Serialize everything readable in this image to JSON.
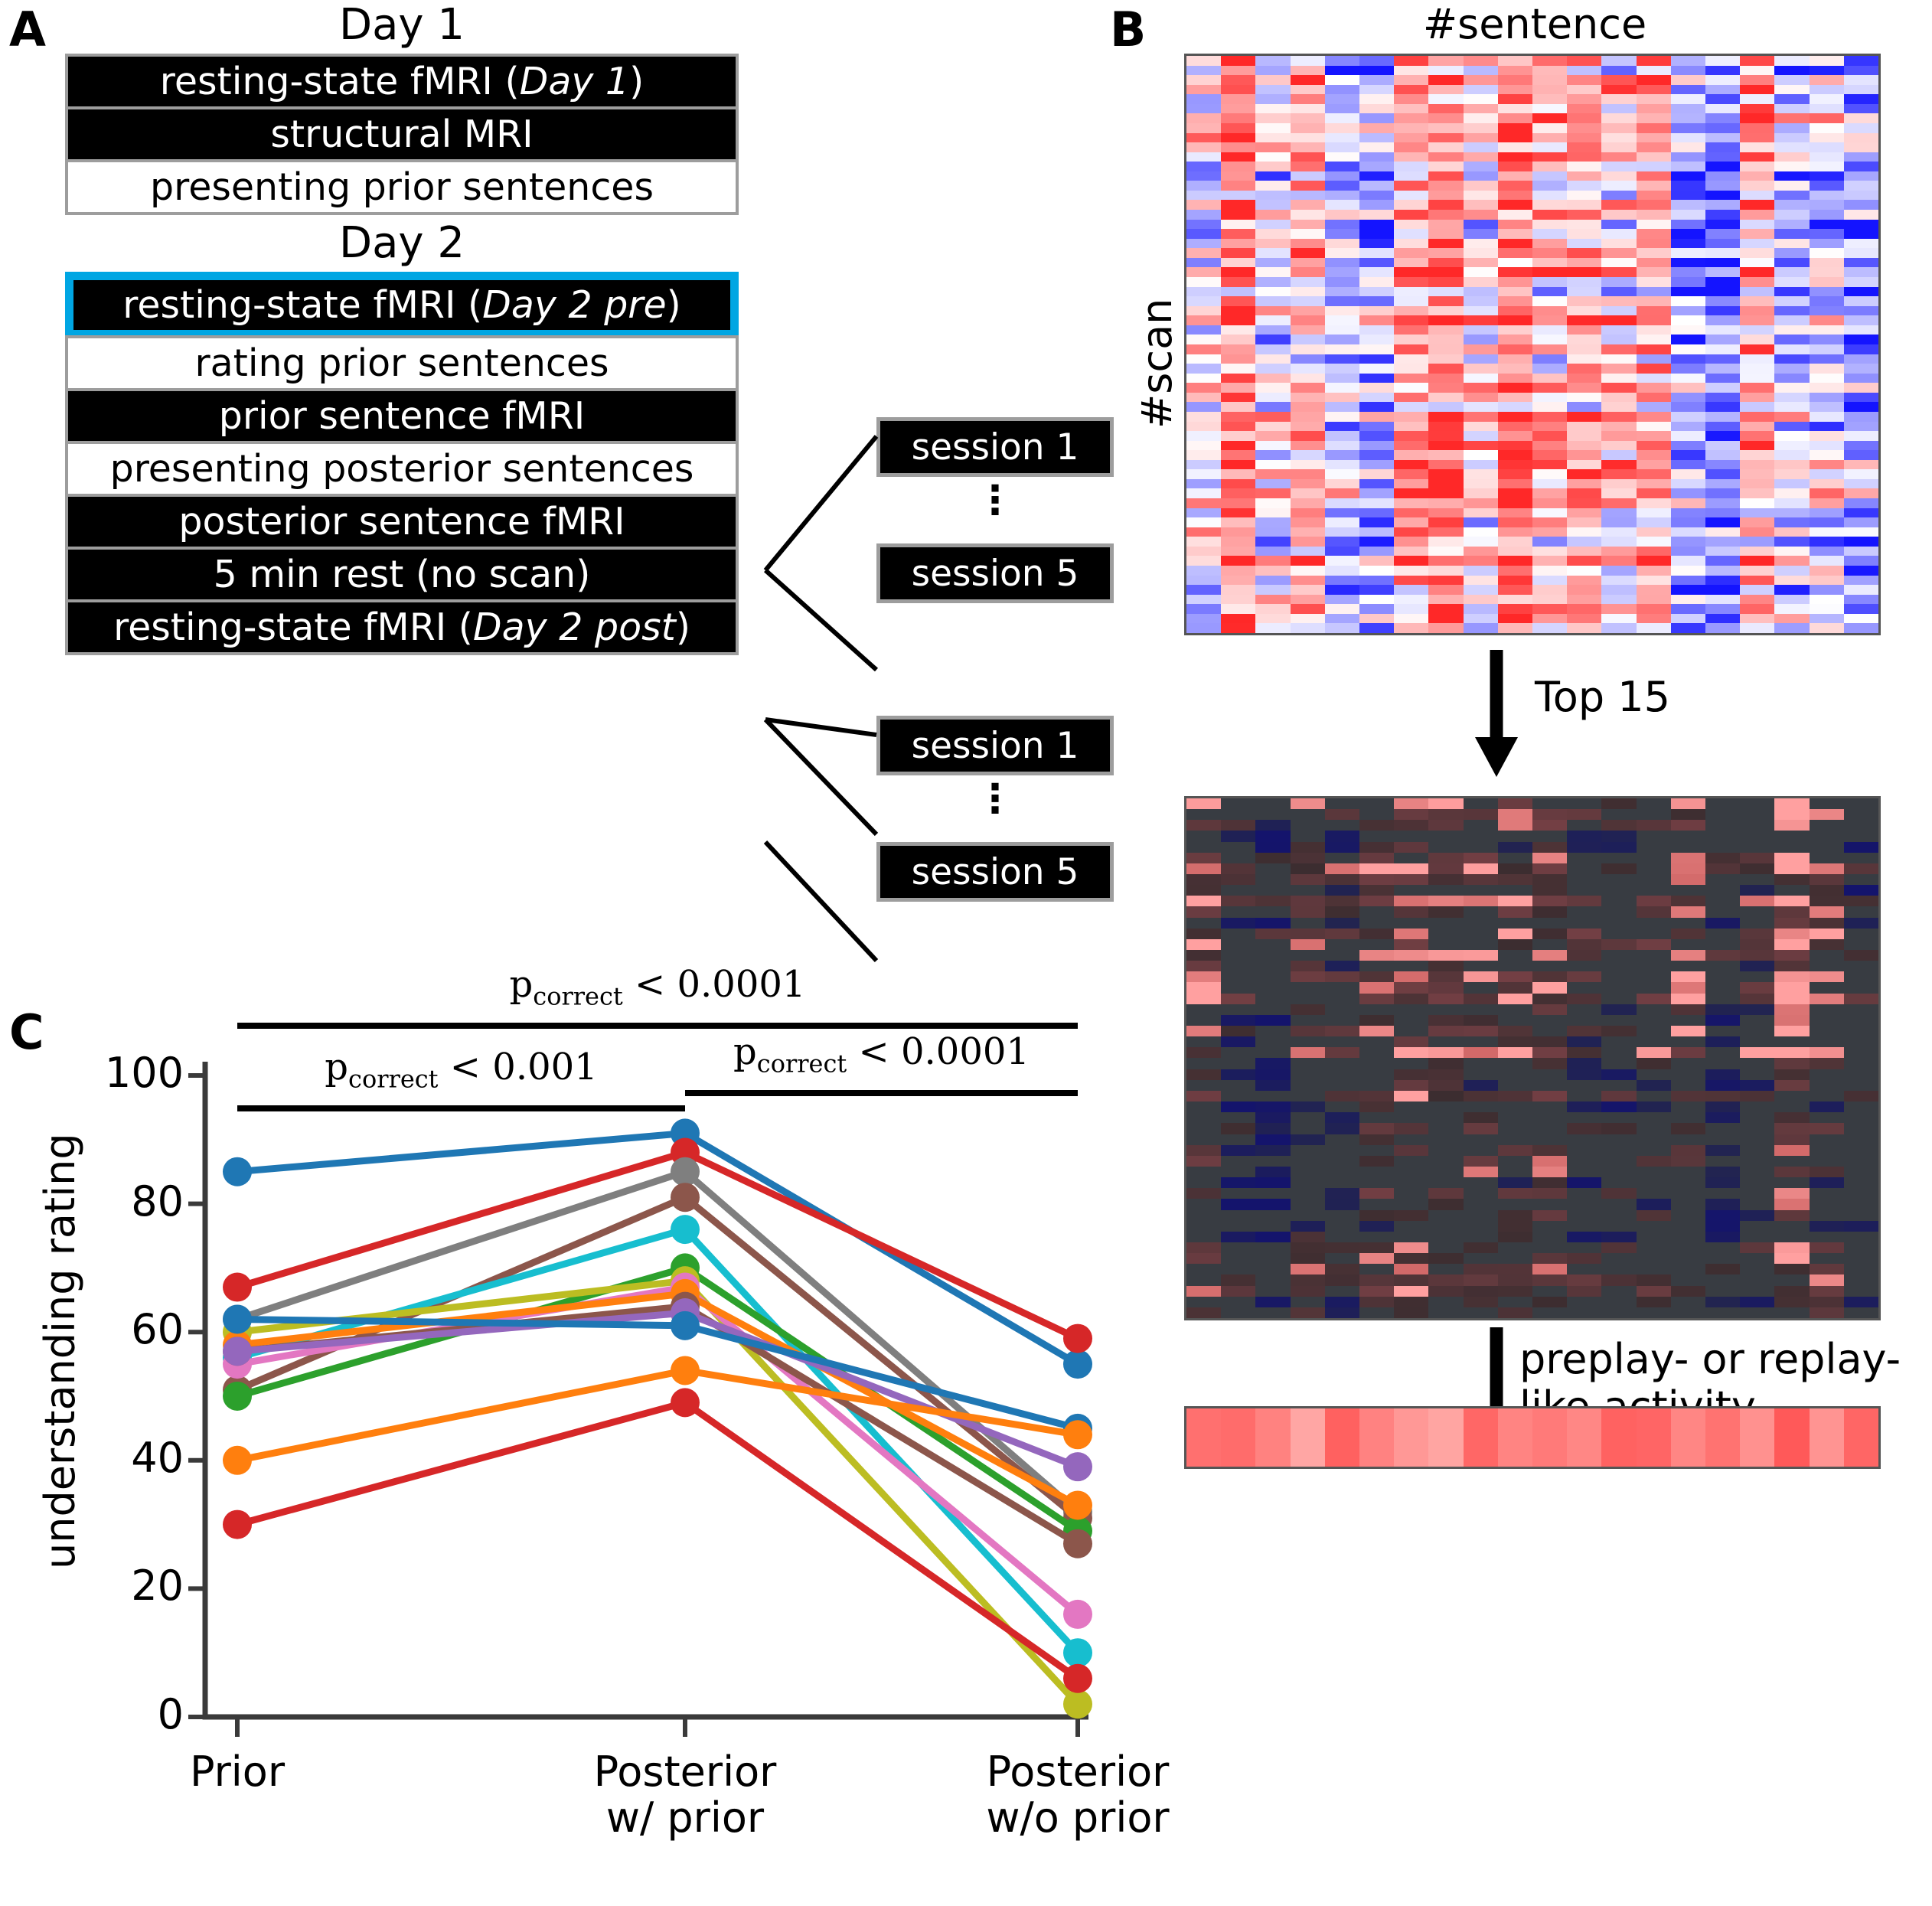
{
  "figure": {
    "panels": [
      {
        "letter": "A"
      },
      {
        "letter": "B"
      },
      {
        "letter": "C"
      }
    ]
  },
  "panelA": {
    "letter": "A",
    "day1": {
      "title": "Day 1",
      "steps": [
        {
          "label": "resting-state fMRI (",
          "italic": "Day 1",
          "tail": ")",
          "style": "dark"
        },
        {
          "label": "structural MRI",
          "italic": "",
          "tail": "",
          "style": "dark"
        },
        {
          "label": "presenting prior sentences",
          "italic": "",
          "tail": "",
          "style": "light"
        }
      ]
    },
    "day2": {
      "title": "Day 2",
      "steps": [
        {
          "label": "resting-state fMRI (",
          "italic": "Day 2 pre",
          "tail": ")",
          "style": "dark",
          "highlight": true
        },
        {
          "label": "rating prior sentences",
          "italic": "",
          "tail": "",
          "style": "light"
        },
        {
          "label": "prior sentence fMRI",
          "italic": "",
          "tail": "",
          "style": "dark"
        },
        {
          "label": "presenting posterior sentences",
          "italic": "",
          "tail": "",
          "style": "light"
        },
        {
          "label": "posterior sentence fMRI",
          "italic": "",
          "tail": "",
          "style": "dark"
        },
        {
          "label": "5 min rest (no scan)",
          "italic": "",
          "tail": "",
          "style": "dark"
        },
        {
          "label": "resting-state fMRI (",
          "italic": "Day 2 post",
          "tail": ")",
          "style": "dark"
        }
      ]
    },
    "session_groups": [
      {
        "first": "session 1",
        "dots": "⋮",
        "last": "session 5"
      },
      {
        "first": "session 1",
        "dots": "⋮",
        "last": "session 5"
      }
    ],
    "highlight_color": "#00a6e3",
    "box_border_color": "#9d9d9d"
  },
  "panelB": {
    "letter": "B",
    "x_axis_label": "#sentence",
    "y_axis_label": "#scan",
    "arrow1_label": "Top 15",
    "arrow2_label_line1": "preplay- or replay-",
    "arrow2_label_line2": "like activity",
    "heatmap1": {
      "rows": 60,
      "cols": 20,
      "colormap": "blue-white-red"
    },
    "heatmap2": {
      "rows": 48,
      "cols": 20,
      "colormap": "dark-navy-salmon"
    },
    "heatmap3": {
      "rows": 1,
      "cols": 20,
      "colormap": "salmon-red"
    }
  },
  "panelC": {
    "letter": "C",
    "significance": [
      {
        "text_prefix": "p",
        "text_sub": "correct",
        "text_suffix": " < 0.0001",
        "from": 0,
        "to": 2,
        "level": 0
      },
      {
        "text_prefix": "p",
        "text_sub": "correct",
        "text_suffix": " < 0.001",
        "from": 0,
        "to": 1,
        "level": 1
      },
      {
        "text_prefix": "p",
        "text_sub": "correct",
        "text_suffix": " < 0.0001",
        "from": 1,
        "to": 2,
        "level": 1
      }
    ]
  },
  "chart_data": {
    "type": "line",
    "title": "",
    "xlabel": "",
    "ylabel": "understanding rating",
    "categories": [
      "Prior",
      "Posterior\nw/ prior",
      "Posterior\nw/o prior"
    ],
    "category_lines": [
      [
        "Prior"
      ],
      [
        "Posterior",
        "w/ prior"
      ],
      [
        "Posterior",
        "w/o prior"
      ]
    ],
    "ylim": [
      0,
      100
    ],
    "yticks": [
      0,
      20,
      40,
      60,
      80,
      100
    ],
    "grid": false,
    "legend": "none",
    "series": [
      {
        "name": "s01",
        "color": "#1f77b4",
        "values": [
          85,
          91,
          55
        ]
      },
      {
        "name": "s02",
        "color": "#d62728",
        "values": [
          67,
          88,
          59
        ]
      },
      {
        "name": "s03",
        "color": "#7f7f7f",
        "values": [
          62,
          85,
          32
        ]
      },
      {
        "name": "s04",
        "color": "#8c564b",
        "values": [
          51,
          81,
          31
        ]
      },
      {
        "name": "s05",
        "color": "#17becf",
        "values": [
          56,
          76,
          10
        ]
      },
      {
        "name": "s06",
        "color": "#2ca02c",
        "values": [
          50,
          70,
          29
        ]
      },
      {
        "name": "s07",
        "color": "#bcbd22",
        "values": [
          60,
          68,
          2
        ]
      },
      {
        "name": "s08",
        "color": "#e377c2",
        "values": [
          55,
          67,
          16
        ]
      },
      {
        "name": "s09",
        "color": "#ff7f0e",
        "values": [
          58,
          66,
          33
        ]
      },
      {
        "name": "s10",
        "color": "#8c564b",
        "values": [
          57,
          64,
          27
        ]
      },
      {
        "name": "s11",
        "color": "#9467bd",
        "values": [
          57,
          63,
          39
        ]
      },
      {
        "name": "s12",
        "color": "#1f77b4",
        "values": [
          62,
          61,
          45
        ]
      },
      {
        "name": "s13",
        "color": "#ff7f0e",
        "values": [
          40,
          54,
          44
        ]
      },
      {
        "name": "s14",
        "color": "#d62728",
        "values": [
          30,
          49,
          6
        ]
      }
    ]
  }
}
